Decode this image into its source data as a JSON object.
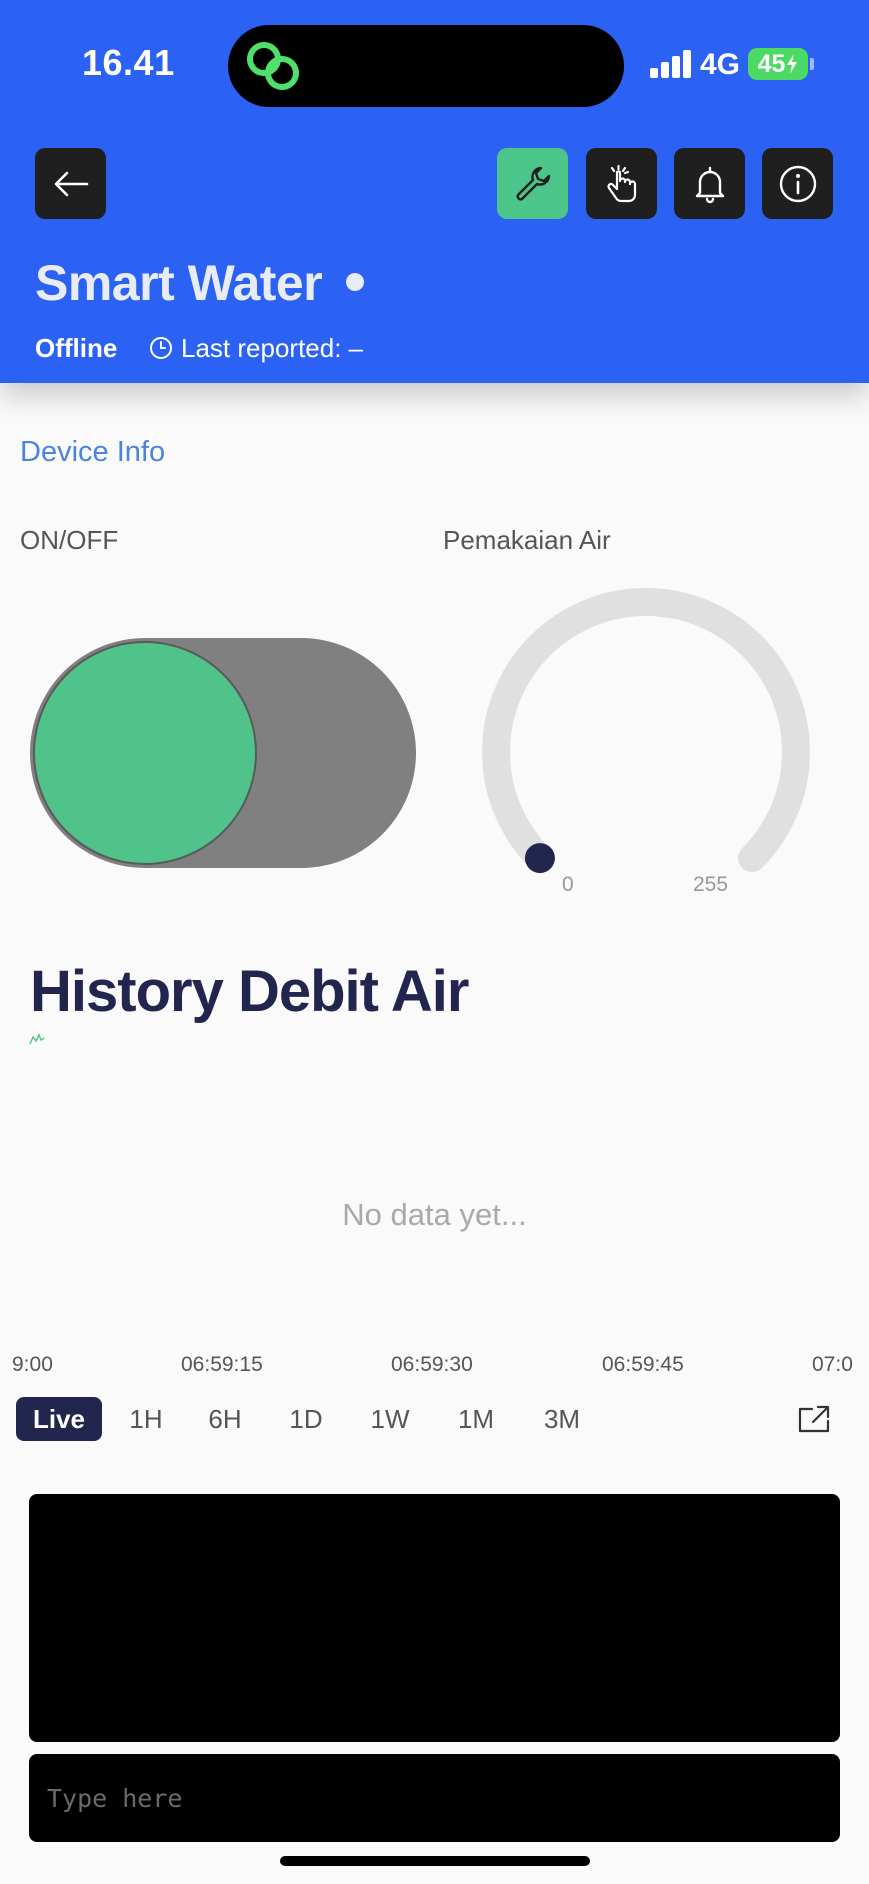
{
  "status_bar": {
    "time": "16.41",
    "network": "4G",
    "battery": "45",
    "battery_color": "#4cd964"
  },
  "header": {
    "background": "#2b62f3",
    "title": "Smart Water",
    "status": "Offline",
    "last_reported": "Last reported: –",
    "buttons": [
      {
        "name": "back-icon"
      },
      {
        "name": "wrench-icon",
        "active": true
      },
      {
        "name": "tap-hand-icon"
      },
      {
        "name": "bell-icon"
      },
      {
        "name": "info-icon"
      }
    ]
  },
  "content": {
    "section_label": "Device Info",
    "switch": {
      "label": "ON/OFF",
      "on_color": "#4fc38a"
    },
    "gauge": {
      "label": "Pemakaian Air",
      "min": "0",
      "max": "255",
      "value": 0
    },
    "history": {
      "title": "History Debit Air",
      "empty_message": "No data yet...",
      "x_ticks": [
        "9:00",
        "06:59:15",
        "06:59:30",
        "06:59:45",
        "07:0"
      ],
      "periods": [
        "Live",
        "1H",
        "6H",
        "1D",
        "1W",
        "1M",
        "3M"
      ],
      "active_period": "Live"
    },
    "terminal": {
      "placeholder": "Type here"
    }
  }
}
